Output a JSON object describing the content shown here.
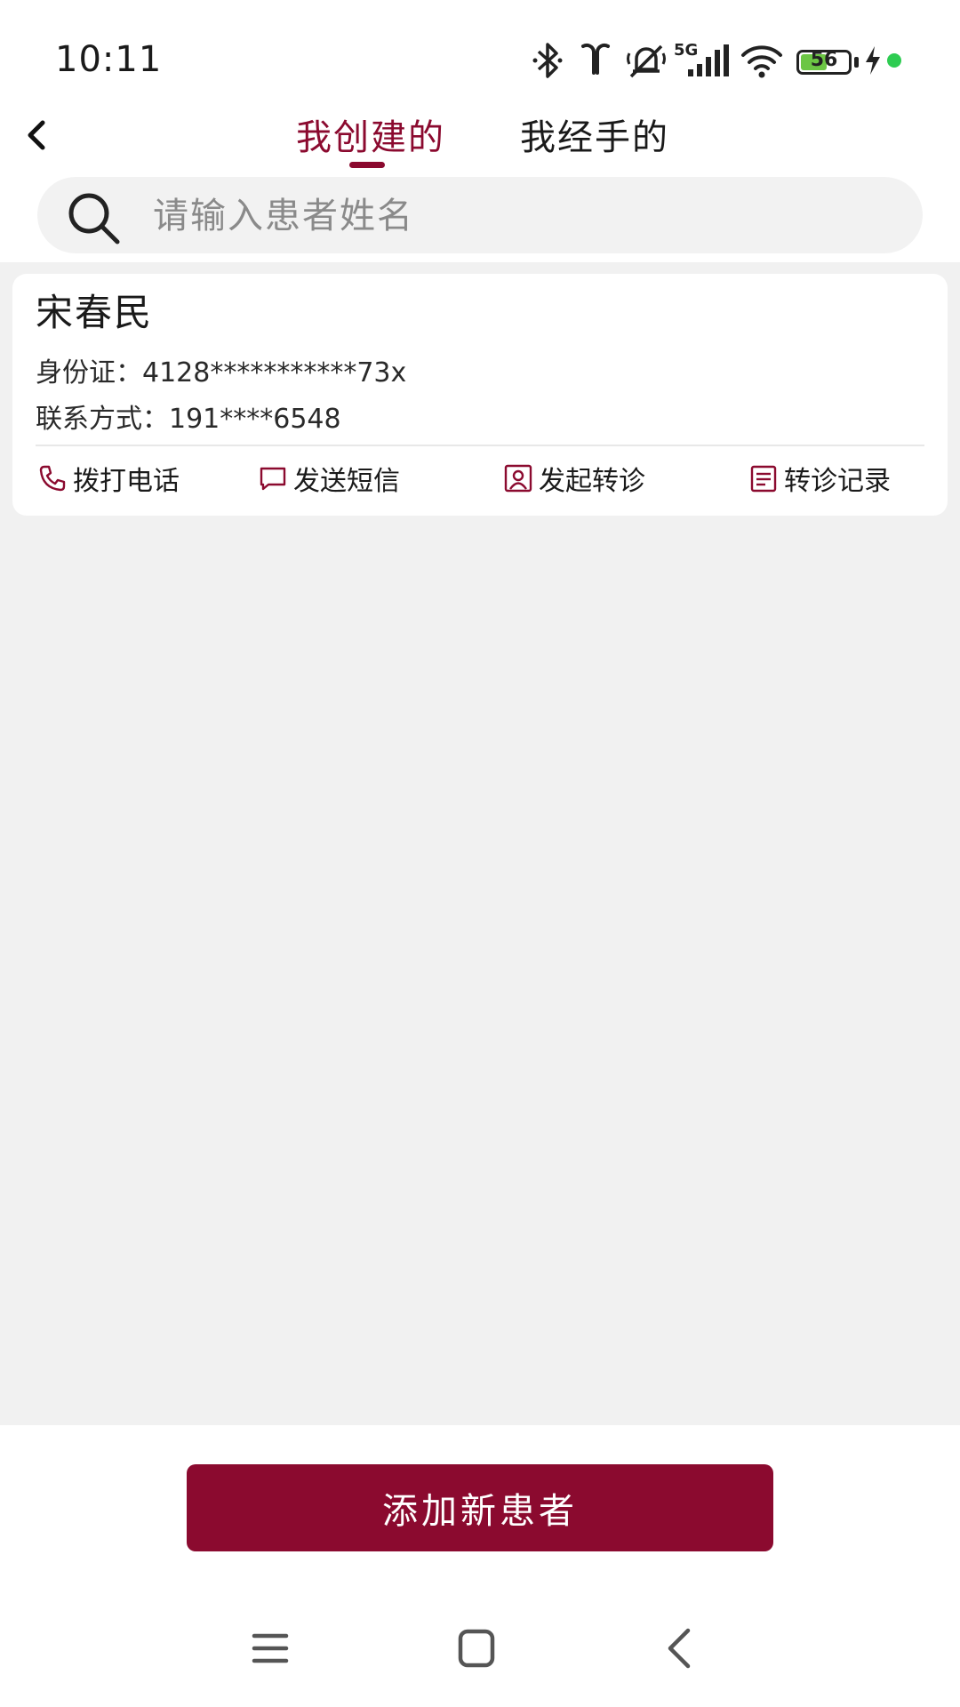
{
  "status_bar": {
    "time": "10:11",
    "network": "5G",
    "battery_level": "56",
    "icons": [
      "bluetooth-icon",
      "earbuds-icon",
      "muted-bell-icon",
      "signal-icon",
      "wifi-icon",
      "battery-icon",
      "charging-icon",
      "green-dot-indicator"
    ]
  },
  "header": {
    "tabs": [
      {
        "label": "我创建的",
        "active": true
      },
      {
        "label": "我经手的",
        "active": false
      }
    ],
    "accent_color": "#8b0a2f"
  },
  "search": {
    "placeholder": "请输入患者姓名",
    "value": ""
  },
  "patients": [
    {
      "name": "宋春民",
      "id_label": "身份证：",
      "id_value": "4128***********73x",
      "phone_label": "联系方式：",
      "phone_value": "191****6548",
      "actions": [
        {
          "label": "拨打电话",
          "icon": "phone-icon"
        },
        {
          "label": "发送短信",
          "icon": "message-icon"
        },
        {
          "label": "发起转诊",
          "icon": "referral-icon"
        },
        {
          "label": "转诊记录",
          "icon": "records-icon"
        }
      ]
    }
  ],
  "footer": {
    "add_button_label": "添加新患者"
  }
}
